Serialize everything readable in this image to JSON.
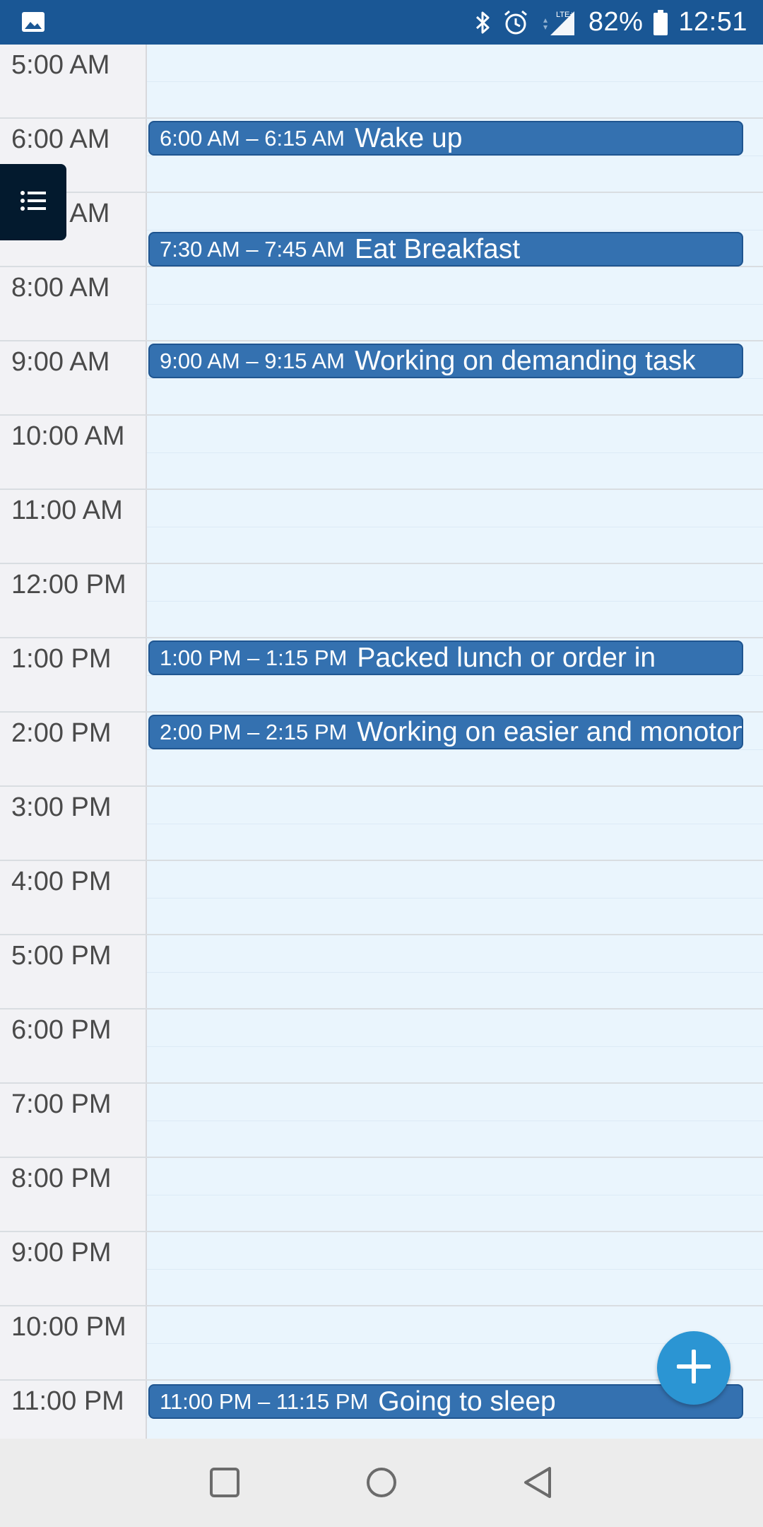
{
  "status_bar": {
    "battery": "82%",
    "time": "12:51",
    "network": "LTE+",
    "icons": [
      "image-icon",
      "bluetooth-icon",
      "alarm-icon",
      "signal-icon",
      "battery-icon"
    ]
  },
  "hours": [
    "5:00 AM",
    "6:00 AM",
    "7:00 AM",
    "8:00 AM",
    "9:00 AM",
    "10:00 AM",
    "11:00 AM",
    "12:00 PM",
    "1:00 PM",
    "2:00 PM",
    "3:00 PM",
    "4:00 PM",
    "5:00 PM",
    "6:00 PM",
    "7:00 PM",
    "8:00 PM",
    "9:00 PM",
    "10:00 PM",
    "11:00 PM"
  ],
  "events": [
    {
      "time": "6:00 AM – 6:15 AM",
      "title": "Wake up"
    },
    {
      "time": "7:30 AM – 7:45 AM",
      "title": "Eat Breakfast"
    },
    {
      "time": "9:00 AM – 9:15 AM",
      "title": "Working on demanding task"
    },
    {
      "time": "1:00 PM – 1:15 PM",
      "title": "Packed lunch or order in"
    },
    {
      "time": "2:00 PM – 2:15 PM",
      "title": "Working on easier and monotonous"
    },
    {
      "time": "11:00 PM – 11:15 PM",
      "title": "Going to sleep"
    }
  ],
  "colors": {
    "status_bar": "#1a5795",
    "event_fill": "#3471b0",
    "grid_bg": "#eaf5fd",
    "fab": "#2b95d3",
    "menu_button": "#031a2e"
  }
}
